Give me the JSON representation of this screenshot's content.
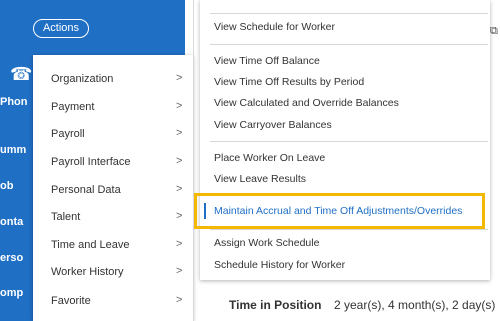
{
  "actions_button": "Actions",
  "side_labels": [
    "Phon",
    "umm",
    "ob",
    "onta",
    "erso",
    "omp"
  ],
  "menu1": {
    "items": [
      {
        "label": "Organization"
      },
      {
        "label": "Payment"
      },
      {
        "label": "Payroll"
      },
      {
        "label": "Payroll Interface"
      },
      {
        "label": "Personal Data"
      },
      {
        "label": "Talent"
      },
      {
        "label": "Time and Leave"
      },
      {
        "label": "Worker History"
      },
      {
        "label": "Favorite"
      }
    ],
    "chevron": ">"
  },
  "menu2": {
    "items": [
      "View Schedule for Worker",
      "View Time Off Balance",
      "View Time Off Results by Period",
      "View Calculated and Override Balances",
      "View Carryover Balances",
      "Place Worker On Leave",
      "View Leave Results",
      "Maintain Accrual and Time Off Adjustments/Overrides",
      "Assign Work Schedule",
      "Schedule History for Worker"
    ]
  },
  "field": {
    "label": "Time in Position",
    "value": "2 year(s), 4 month(s), 2 day(s)"
  },
  "colors": {
    "blue": "#1f6fc5",
    "highlight": "#f3b800"
  },
  "icons": {
    "phone": "phone-icon",
    "corner": "window-icon"
  }
}
